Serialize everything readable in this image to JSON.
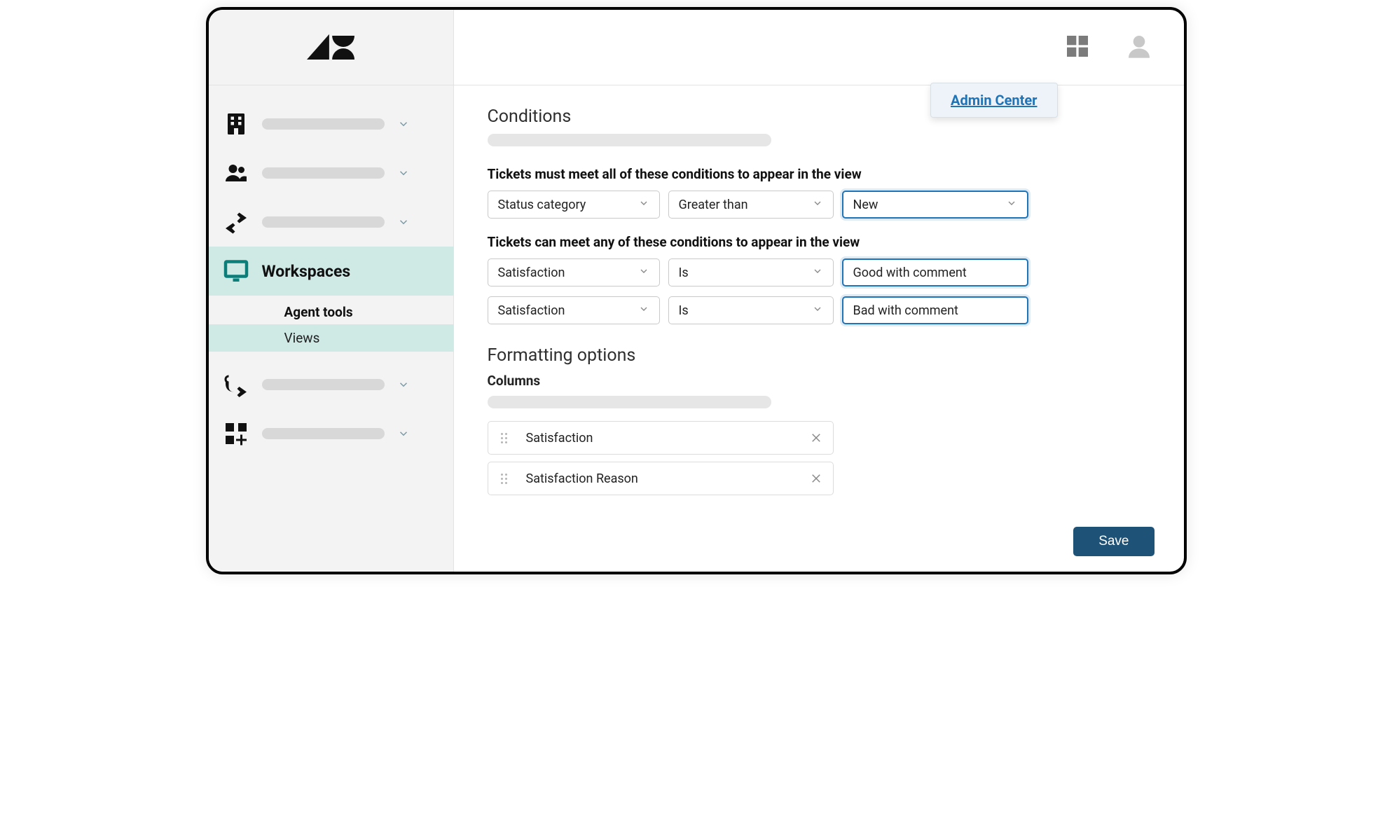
{
  "popup": {
    "link": "Admin Center"
  },
  "sidebar": {
    "items": [
      {
        "icon": "building"
      },
      {
        "icon": "users"
      },
      {
        "icon": "arrows"
      },
      {
        "icon": "workspace",
        "label": "Workspaces",
        "active": true
      },
      {
        "icon": "route"
      },
      {
        "icon": "appsplus"
      }
    ],
    "sub": {
      "title": "Agent tools",
      "selected": "Views"
    }
  },
  "conditions": {
    "heading": "Conditions",
    "all_label": "Tickets must meet all of these conditions to appear in the view",
    "all_rows": [
      {
        "field": "Status category",
        "operator": "Greater than",
        "value": "New"
      }
    ],
    "any_label": "Tickets can meet any of these conditions to appear in the view",
    "any_rows": [
      {
        "field": "Satisfaction",
        "operator": "Is",
        "value": "Good with comment"
      },
      {
        "field": "Satisfaction",
        "operator": "Is",
        "value": "Bad with comment"
      }
    ]
  },
  "formatting": {
    "heading": "Formatting options",
    "columns_label": "Columns",
    "columns": [
      "Satisfaction",
      "Satisfaction Reason"
    ]
  },
  "save_label": "Save"
}
